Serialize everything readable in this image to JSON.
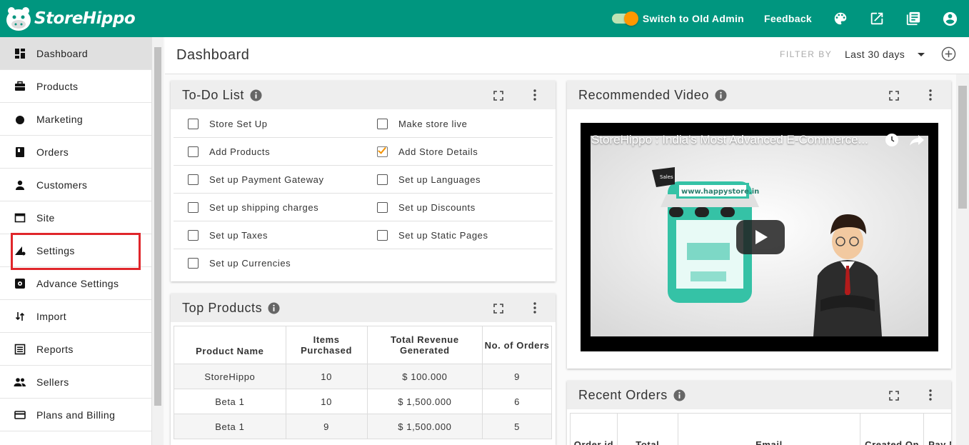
{
  "header": {
    "logo_text": "StoreHippo",
    "switch_label": "Switch to Old Admin",
    "feedback_label": "Feedback",
    "colors": {
      "header_bg": "#00967f",
      "accent": "#ff9800"
    },
    "icons": [
      "palette-icon",
      "open-in-new-icon",
      "library-books-icon",
      "account-circle-icon"
    ]
  },
  "sidebar": {
    "items": [
      {
        "label": "Dashboard",
        "icon": "dashboard-icon"
      },
      {
        "label": "Products",
        "icon": "briefcase-icon"
      },
      {
        "label": "Marketing",
        "icon": "dot-icon"
      },
      {
        "label": "Orders",
        "icon": "book-icon"
      },
      {
        "label": "Customers",
        "icon": "person-icon"
      },
      {
        "label": "Site",
        "icon": "window-icon"
      },
      {
        "label": "Settings",
        "icon": "settings-sliders-icon"
      },
      {
        "label": "Advance Settings",
        "icon": "gear-box-icon"
      },
      {
        "label": "Import",
        "icon": "import-arrows-icon"
      },
      {
        "label": "Reports",
        "icon": "list-icon"
      },
      {
        "label": "Sellers",
        "icon": "people-icon"
      },
      {
        "label": "Plans and Billing",
        "icon": "credit-card-icon"
      }
    ]
  },
  "page": {
    "title": "Dashboard",
    "filter_label": "FILTER BY",
    "filter_value": "Last 30 days"
  },
  "todo": {
    "title": "To-Do List",
    "rows": [
      [
        {
          "label": "Store Set Up",
          "checked": false
        },
        {
          "label": "Make store live",
          "checked": false
        }
      ],
      [
        {
          "label": "Add Products",
          "checked": false
        },
        {
          "label": "Add Store Details",
          "checked": true
        }
      ],
      [
        {
          "label": "Set up Payment Gateway",
          "checked": false
        },
        {
          "label": "Set up Languages",
          "checked": false
        }
      ],
      [
        {
          "label": "Set up shipping charges",
          "checked": false
        },
        {
          "label": "Set up Discounts",
          "checked": false
        }
      ],
      [
        {
          "label": "Set up Taxes",
          "checked": false
        },
        {
          "label": "Set up Static Pages",
          "checked": false
        }
      ],
      [
        {
          "label": "Set up Currencies",
          "checked": false
        }
      ]
    ]
  },
  "video": {
    "title": "Recommended Video",
    "video_title": "StoreHippo : India's Most Advanced E-Commerce...",
    "store_url": "www.happystore.in",
    "sales_tag": "Sales"
  },
  "top_products": {
    "title": "Top Products",
    "headers": [
      "Product Name",
      "Items Purchased",
      "Total Revenue Generated",
      "No. of Orders"
    ],
    "rows": [
      [
        "StoreHippo",
        "10",
        "$ 100.000",
        "9"
      ],
      [
        "Beta 1",
        "10",
        "$ 1,500.000",
        "6"
      ],
      [
        "Beta 1",
        "9",
        "$ 1,500.000",
        "5"
      ]
    ]
  },
  "recent_orders": {
    "title": "Recent Orders",
    "headers": [
      "Order id",
      "Total",
      "Email",
      "Created On",
      "Pay Me"
    ]
  }
}
